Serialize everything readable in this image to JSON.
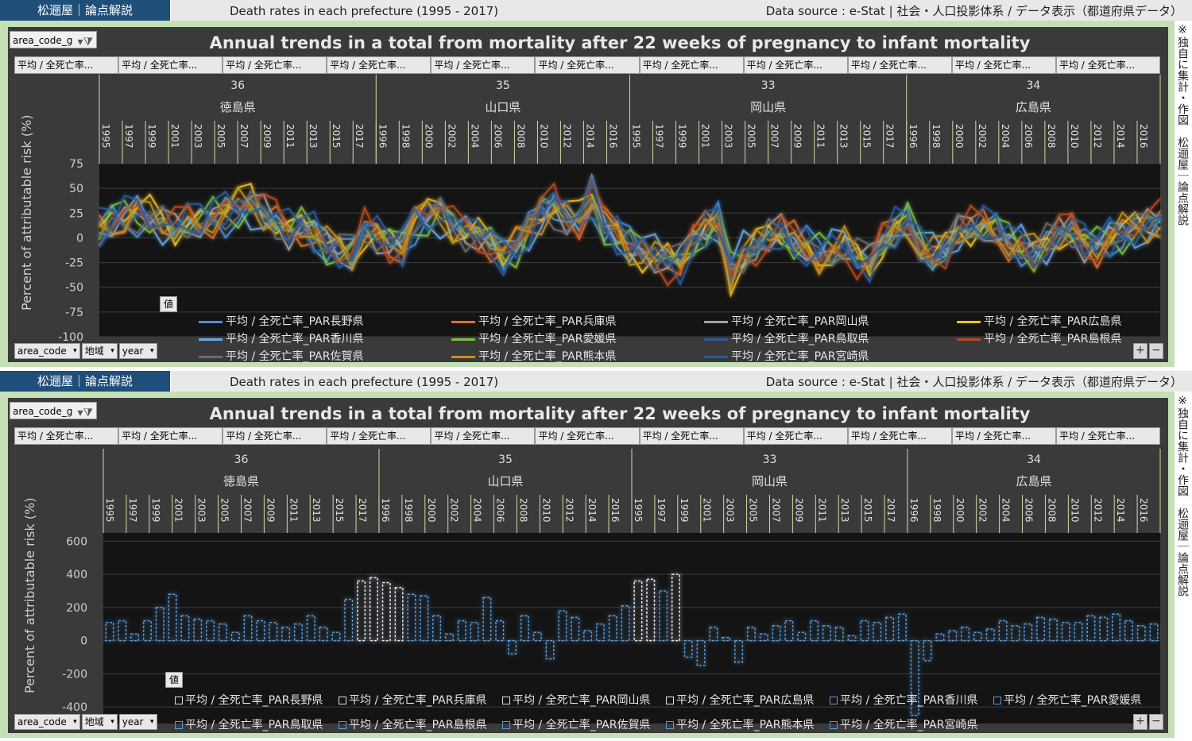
{
  "header": {
    "brand": "松逦屋｜論点解説",
    "title": "Death rates in each prefecture (1995 - 2017)",
    "source": "Data source : e-Stat | 社会・人口投影体系 / データ表示（都道府県データ）"
  },
  "sidenote": "※独自に集計・作図　松逦屋｜論点解説",
  "filter_label": "area_code_g",
  "field_buttons": [
    "平均 / 全死亡率...",
    "平均 / 全死亡率...",
    "平均 / 全死亡率...",
    "平均 / 全死亡率...",
    "平均 / 全死亡率...",
    "平均 / 全死亡率...",
    "平均 / 全死亡率...",
    "平均 / 全死亡率...",
    "平均 / 全死亡率...",
    "平均 / 全死亡率...",
    "平均 / 全死亡率..."
  ],
  "row_buttons": [
    "area_code",
    "地域",
    "year"
  ],
  "value_tag": "値",
  "zoom": {
    "plus": "+",
    "minus": "−"
  },
  "colors": {
    "blue": "#4a90d9",
    "orange": "#e0702a",
    "gray": "#a0a0a0",
    "yellow": "#f0c020",
    "lightblue": "#6aa8e8",
    "green": "#7cc040",
    "navy": "#2a5a9a",
    "rust": "#b84a20",
    "darkgray": "#6a6a6a",
    "gold": "#c09020"
  },
  "chart_data": [
    {
      "type": "line",
      "title": "Annual trends in a total from mortality after 22 weeks of pregnancy to infant mortality",
      "ylabel": "Percent of attributable risk (%)",
      "ylim": [
        -100,
        75
      ],
      "yticks": [
        75,
        50,
        25,
        0,
        -25,
        -50,
        -75,
        -100
      ],
      "groups": [
        {
          "code": "36",
          "name": "徳島県",
          "years": [
            "1995",
            "1997",
            "1999",
            "2001",
            "2003",
            "2005",
            "2007",
            "2009",
            "2011",
            "2013",
            "2015",
            "2017"
          ]
        },
        {
          "code": "35",
          "name": "山口県",
          "years": [
            "1996",
            "1998",
            "2000",
            "2002",
            "2004",
            "2006",
            "2008",
            "2010",
            "2012",
            "2014",
            "2016"
          ]
        },
        {
          "code": "33",
          "name": "岡山県",
          "years": [
            "1995",
            "1997",
            "1999",
            "2001",
            "2003",
            "2005",
            "2007",
            "2009",
            "2011",
            "2013",
            "2015",
            "2017"
          ]
        },
        {
          "code": "34",
          "name": "広島県",
          "years": [
            "1996",
            "1998",
            "2000",
            "2002",
            "2004",
            "2006",
            "2008",
            "2010",
            "2012",
            "2014",
            "2016"
          ]
        }
      ],
      "legend": [
        "平均 / 全死亡率_PAR長野県",
        "平均 / 全死亡率_PAR兵庫県",
        "平均 / 全死亡率_PAR岡山県",
        "平均 / 全死亡率_PAR広島県",
        "平均 / 全死亡率_PAR香川県",
        "平均 / 全死亡率_PAR愛媛県",
        "平均 / 全死亡率_PAR鳥取県",
        "平均 / 全死亡率_PAR島根県",
        "平均 / 全死亡率_PAR佐賀県",
        "平均 / 全死亡率_PAR熊本県",
        "平均 / 全死亡率_PAR宮崎県"
      ],
      "series_colors": [
        "blue",
        "orange",
        "gray",
        "yellow",
        "lightblue",
        "green",
        "navy",
        "rust",
        "darkgray",
        "gold",
        "navy"
      ],
      "profile": [
        10,
        20,
        25,
        30,
        22,
        15,
        10,
        20,
        18,
        25,
        30,
        35,
        38,
        28,
        20,
        10,
        15,
        5,
        -10,
        -15,
        -20,
        10,
        5,
        -5,
        -10,
        20,
        25,
        30,
        15,
        10,
        5,
        -5,
        -20,
        -10,
        10,
        30,
        40,
        25,
        20,
        45,
        15,
        5,
        -10,
        -15,
        -20,
        -25,
        -30,
        -5,
        10,
        20,
        -40,
        -20,
        -10,
        0,
        5,
        -5,
        -10,
        -20,
        -15,
        -10,
        -25,
        -30,
        -5,
        10,
        20,
        -10,
        -20,
        -15,
        5,
        10,
        15,
        10,
        -5,
        -10,
        -20,
        -10,
        5,
        10,
        -5,
        -10,
        0,
        5,
        10,
        15,
        20
      ]
    },
    {
      "type": "bar",
      "title": "Annual trends in a total from mortality after 22 weeks of pregnancy to infant mortality",
      "ylabel": "Percent of attributable risk (%)",
      "ylim": [
        -500,
        650
      ],
      "yticks": [
        600,
        400,
        200,
        0,
        -200,
        -400
      ],
      "groups": [
        {
          "code": "36",
          "name": "徳島県",
          "years": [
            "1995",
            "1997",
            "1999",
            "2001",
            "2003",
            "2005",
            "2007",
            "2009",
            "2011",
            "2013",
            "2015",
            "2017"
          ]
        },
        {
          "code": "35",
          "name": "山口県",
          "years": [
            "1996",
            "1998",
            "2000",
            "2002",
            "2004",
            "2006",
            "2008",
            "2010",
            "2012",
            "2014",
            "2016"
          ]
        },
        {
          "code": "33",
          "name": "岡山県",
          "years": [
            "1995",
            "1997",
            "1999",
            "2001",
            "2003",
            "2005",
            "2007",
            "2009",
            "2011",
            "2013",
            "2015",
            "2017"
          ]
        },
        {
          "code": "34",
          "name": "広島県",
          "years": [
            "1996",
            "1998",
            "2000",
            "2002",
            "2004",
            "2006",
            "2008",
            "2010",
            "2012",
            "2014",
            "2016"
          ]
        }
      ],
      "legend": [
        "平均 / 全死亡率_PAR長野県",
        "平均 / 全死亡率_PAR兵庫県",
        "平均 / 全死亡率_PAR岡山県",
        "平均 / 全死亡率_PAR広島県",
        "平均 / 全死亡率_PAR香川県",
        "平均 / 全死亡率_PAR愛媛県",
        "平均 / 全死亡率_PAR鳥取県",
        "平均 / 全死亡率_PAR島根県",
        "平均 / 全死亡率_PAR佐賀県",
        "平均 / 全死亡率_PAR熊本県",
        "平均 / 全死亡率_PAR宮崎県"
      ],
      "values": [
        110,
        120,
        40,
        120,
        200,
        280,
        150,
        130,
        120,
        100,
        50,
        150,
        120,
        110,
        80,
        100,
        150,
        80,
        50,
        250,
        360,
        380,
        350,
        320,
        280,
        270,
        150,
        40,
        120,
        110,
        260,
        120,
        -80,
        150,
        50,
        -110,
        180,
        140,
        60,
        100,
        150,
        210,
        360,
        370,
        300,
        400,
        -100,
        -150,
        80,
        20,
        -130,
        80,
        40,
        90,
        120,
        50,
        120,
        90,
        80,
        30,
        120,
        110,
        140,
        160,
        -450,
        -120,
        40,
        60,
        80,
        50,
        70,
        120,
        90,
        100,
        140,
        130,
        110,
        110,
        150,
        140,
        160,
        120,
        90,
        100
      ]
    }
  ]
}
